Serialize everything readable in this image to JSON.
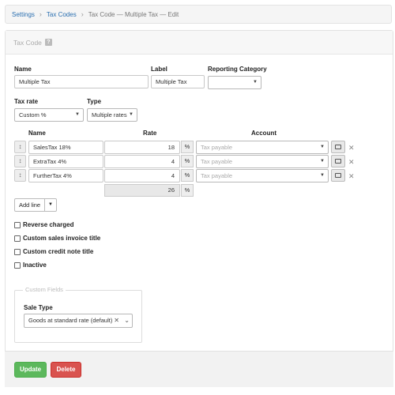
{
  "breadcrumb": {
    "settings": "Settings",
    "tax_codes": "Tax Codes",
    "current": "Tax Code — Multiple Tax — Edit"
  },
  "panel": {
    "title": "Tax Code",
    "help": "?"
  },
  "form": {
    "name_label": "Name",
    "name_value": "Multiple Tax",
    "label_label": "Label",
    "label_value": "Multiple Tax",
    "reporting_label": "Reporting Category",
    "reporting_value": "",
    "tax_rate_label": "Tax rate",
    "tax_rate_value": "Custom %",
    "type_label": "Type",
    "type_value": "Multiple rates"
  },
  "table": {
    "headers": {
      "name": "Name",
      "rate": "Rate",
      "account": "Account"
    },
    "rows": [
      {
        "name": "SalesTax 18%",
        "rate": "18",
        "unit": "%",
        "account": "Tax payable"
      },
      {
        "name": "ExtraTax 4%",
        "rate": "4",
        "unit": "%",
        "account": "Tax payable"
      },
      {
        "name": "FurtherTax 4%",
        "rate": "4",
        "unit": "%",
        "account": "Tax payable"
      }
    ],
    "total": "26",
    "total_unit": "%",
    "add_line": "Add line"
  },
  "checkboxes": {
    "reverse_charged": "Reverse charged",
    "custom_sales_invoice_title": "Custom sales invoice title",
    "custom_credit_note_title": "Custom credit note title",
    "inactive": "Inactive"
  },
  "custom_fields": {
    "legend": "Custom Fields",
    "sale_type_label": "Sale Type",
    "sale_type_value": "Goods at standard rate (default)"
  },
  "buttons": {
    "update": "Update",
    "delete": "Delete"
  }
}
